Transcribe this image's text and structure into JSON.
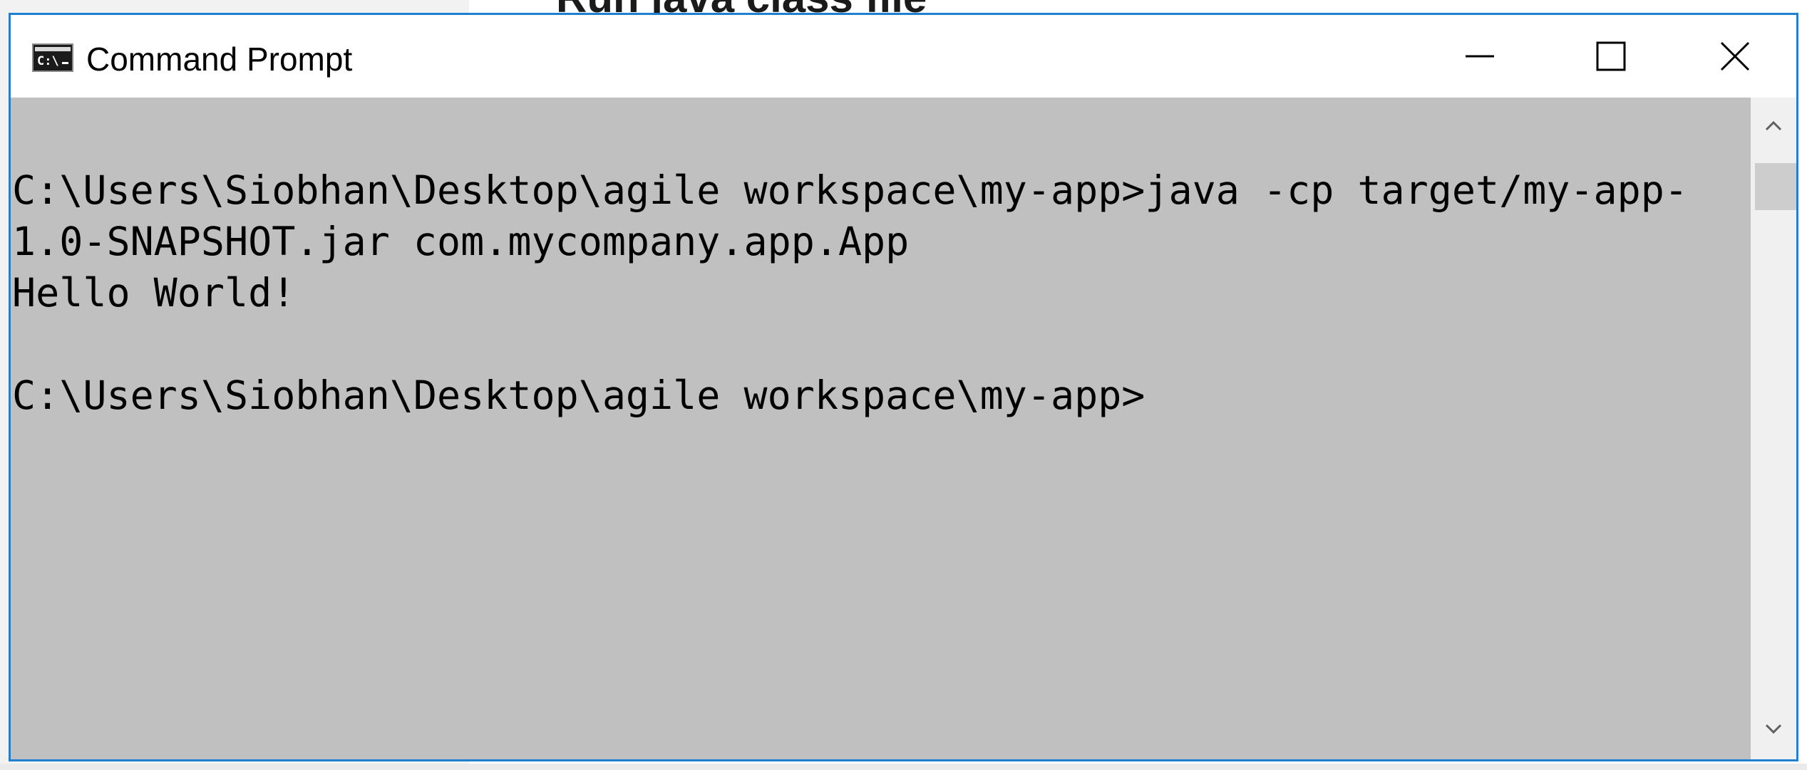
{
  "background": {
    "heading_fragment": "Run java class file"
  },
  "window": {
    "title": "Command Prompt",
    "icon": "cmd-icon",
    "controls": {
      "minimize": "minimize-icon",
      "maximize": "maximize-icon",
      "close": "close-icon"
    },
    "border_color": "#1f7fd1"
  },
  "console": {
    "background": "#c0c0c0",
    "text_color": "#000000",
    "lines": [
      "C:\\Users\\Siobhan\\Desktop\\agile workspace\\my-app>java -cp target/my-app-",
      "1.0-SNAPSHOT.jar com.mycompany.app.App",
      "Hello World!",
      "",
      "C:\\Users\\Siobhan\\Desktop\\agile workspace\\my-app>"
    ]
  },
  "scrollbar": {
    "up_icon": "chevron-up-icon",
    "down_icon": "chevron-down-icon"
  }
}
